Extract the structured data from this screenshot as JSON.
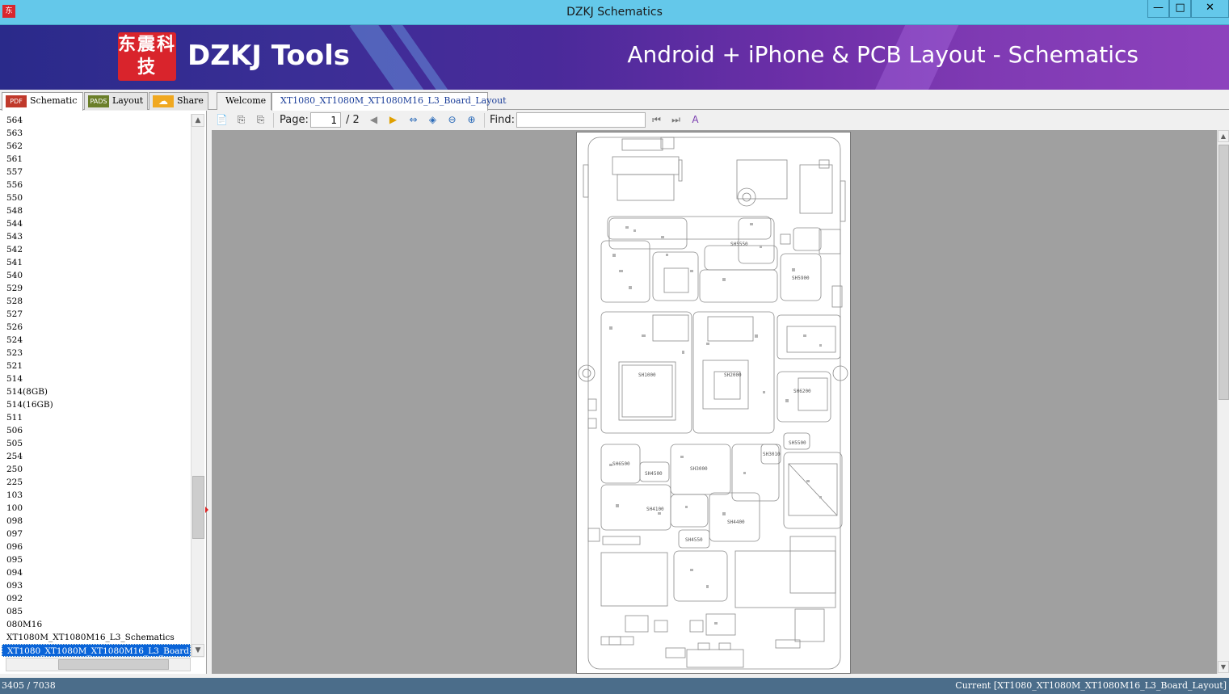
{
  "window": {
    "title": "DZKJ Schematics",
    "app_icon": "dzkj-app-icon",
    "buttons": {
      "minimize": "—",
      "maximize": "□",
      "close": "✕"
    }
  },
  "banner": {
    "logo_text": "东震科技",
    "brand": "DZKJ Tools",
    "tagline": "Android + iPhone & PCB Layout - Schematics"
  },
  "left_tabs": [
    {
      "icon": "PDF",
      "label": "Schematic"
    },
    {
      "icon": "PADS",
      "label": "Layout"
    },
    {
      "icon": "☁",
      "label": "Share"
    }
  ],
  "doc_tabs": [
    {
      "label": "Welcome"
    },
    {
      "label": "XT1080_XT1080M_XT1080M16_L3_Board_Layout"
    }
  ],
  "list": {
    "items": [
      "564",
      "563",
      "562",
      "561",
      "557",
      "556",
      "550",
      "548",
      "544",
      "543",
      "542",
      "541",
      "540",
      "529",
      "528",
      "527",
      "526",
      "524",
      "523",
      "521",
      "514",
      "514(8GB)",
      "514(16GB)",
      "511",
      "506",
      "505",
      "254",
      "250",
      "225",
      "103",
      "100",
      "098",
      "097",
      "096",
      "095",
      "094",
      "093",
      "092",
      "085",
      "080M16",
      "XT1080M_XT1080M16_L3_Schematics",
      "XT1080_XT1080M_XT1080M16_L3_Board_Layout"
    ],
    "selected_index": 41
  },
  "toolbar": {
    "page_label": "Page:",
    "page_current": "1",
    "page_total": "/ 2",
    "find_label": "Find:",
    "find_value": ""
  },
  "board_labels": [
    "SH1000",
    "SH2000",
    "SH3000",
    "SH4100",
    "SH4400",
    "SH4500",
    "SH4550",
    "SH5550",
    "SH5900",
    "SH6200",
    "SH6500",
    "SH5500",
    "SH3010"
  ],
  "status": {
    "left": "3405 / 7038",
    "right": "Current [XT1080_XT1080M_XT1080M16_L3_Board_Layout]"
  }
}
